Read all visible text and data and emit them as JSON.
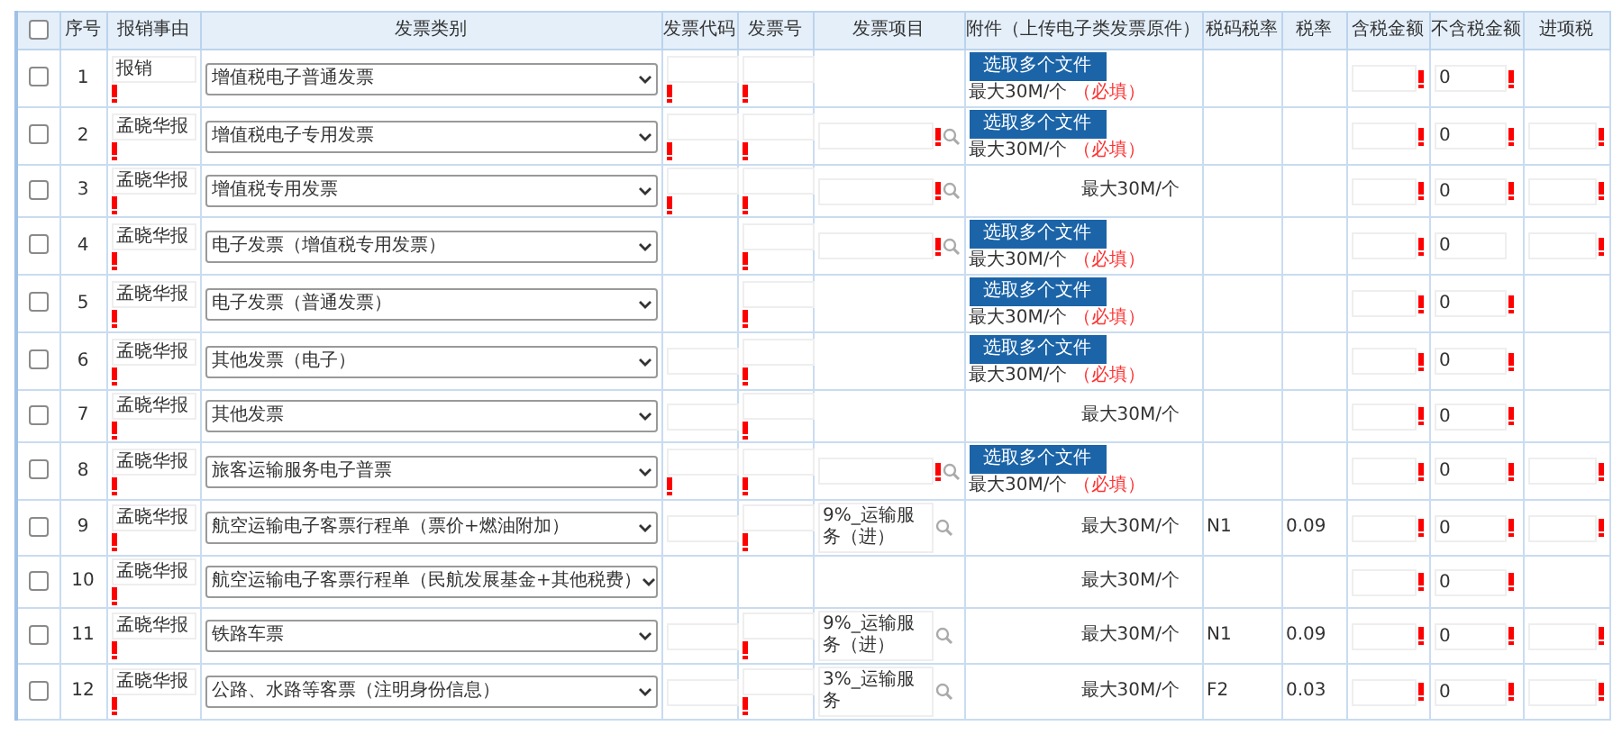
{
  "header": {
    "select_all_checked": false,
    "columns": [
      "序号",
      "报销事由",
      "发票类别",
      "发票代码",
      "发票号",
      "发票项目",
      "附件（上传电子类发票原件）",
      "税码税率",
      "税率",
      "含税金额",
      "不含税金额",
      "进项税"
    ]
  },
  "rows": [
    {
      "checked": false,
      "no": "1",
      "reason": {
        "value": "报销",
        "required": true
      },
      "category": "增值税电子普通发票",
      "code": {
        "required": true
      },
      "number": {
        "required": true
      },
      "attachment": {
        "kind": "upload",
        "button": "选取多个文件",
        "limit": "最大30M/个",
        "note": "（必填）"
      },
      "amount_incl": {
        "required": true
      },
      "amount_excl": {
        "value": "0",
        "required": true
      }
    },
    {
      "checked": false,
      "no": "2",
      "reason": {
        "value": "孟晓华报",
        "required": true
      },
      "category": "增值税电子专用发票",
      "code": {
        "required": true
      },
      "number": {
        "required": true
      },
      "item": {
        "required": true
      },
      "attachment": {
        "kind": "upload",
        "button": "选取多个文件",
        "limit": "最大30M/个",
        "note": "（必填）"
      },
      "amount_incl": {
        "required": true
      },
      "amount_excl": {
        "value": "0",
        "required": true
      },
      "input_tax": {
        "required": true
      }
    },
    {
      "checked": false,
      "no": "3",
      "reason": {
        "value": "孟晓华报",
        "required": true
      },
      "category": "增值税专用发票",
      "code": {
        "required": true
      },
      "number": {
        "required": true
      },
      "item": {
        "required": true
      },
      "attachment": {
        "kind": "note",
        "limit": "最大30M/个"
      },
      "amount_incl": {
        "required": true
      },
      "amount_excl": {
        "value": "0",
        "required": true
      },
      "input_tax": {
        "required": true
      }
    },
    {
      "checked": false,
      "no": "4",
      "reason": {
        "value": "孟晓华报",
        "required": true
      },
      "category": "电子发票（增值税专用发票）",
      "number": {
        "required": true
      },
      "item": {
        "required": true
      },
      "attachment": {
        "kind": "upload",
        "button": "选取多个文件",
        "limit": "最大30M/个",
        "note": "（必填）"
      },
      "amount_incl": {
        "required": true
      },
      "amount_excl": {
        "value": "0",
        "required": false
      },
      "input_tax": {
        "required": true
      }
    },
    {
      "checked": false,
      "no": "5",
      "reason": {
        "value": "孟晓华报",
        "required": true
      },
      "category": "电子发票（普通发票）",
      "number": {
        "required": true
      },
      "attachment": {
        "kind": "upload",
        "button": "选取多个文件",
        "limit": "最大30M/个",
        "note": "（必填）"
      },
      "amount_incl": {
        "required": true
      },
      "amount_excl": {
        "value": "0",
        "required": true
      }
    },
    {
      "checked": false,
      "no": "6",
      "reason": {
        "value": "孟晓华报",
        "required": true
      },
      "category": "其他发票（电子）",
      "code": {
        "required": false
      },
      "number": {
        "required": true
      },
      "attachment": {
        "kind": "upload",
        "button": "选取多个文件",
        "limit": "最大30M/个",
        "note": "（必填）"
      },
      "amount_incl": {
        "required": true
      },
      "amount_excl": {
        "value": "0",
        "required": true
      }
    },
    {
      "checked": false,
      "no": "7",
      "reason": {
        "value": "孟晓华报",
        "required": true
      },
      "category": "其他发票",
      "code": {
        "required": false
      },
      "number": {
        "required": true
      },
      "attachment": {
        "kind": "note",
        "limit": "最大30M/个"
      },
      "amount_incl": {
        "required": true
      },
      "amount_excl": {
        "value": "0",
        "required": true
      }
    },
    {
      "checked": false,
      "no": "8",
      "reason": {
        "value": "孟晓华报",
        "required": true
      },
      "category": "旅客运输服务电子普票",
      "code": {
        "required": true
      },
      "number": {
        "required": true
      },
      "item": {
        "required": true
      },
      "attachment": {
        "kind": "upload",
        "button": "选取多个文件",
        "limit": "最大30M/个",
        "note": "（必填）"
      },
      "amount_incl": {
        "required": true
      },
      "amount_excl": {
        "value": "0",
        "required": true
      },
      "input_tax": {
        "required": true
      }
    },
    {
      "checked": false,
      "no": "9",
      "reason": {
        "value": "孟晓华报",
        "required": true
      },
      "category": "航空运输电子客票行程单（票价+燃油附加）",
      "code": {
        "required": false
      },
      "number": {
        "required": true
      },
      "item": {
        "value": "9%_运输服务（进）",
        "required": false
      },
      "attachment": {
        "kind": "note",
        "limit": "最大30M/个"
      },
      "tax_code": "N1",
      "tax_rate": "0.09",
      "amount_incl": {
        "required": true
      },
      "amount_excl": {
        "value": "0",
        "required": true
      },
      "input_tax": {
        "required": true
      }
    },
    {
      "checked": false,
      "no": "10",
      "reason": {
        "value": "孟晓华报",
        "required": true
      },
      "category": "航空运输电子客票行程单（民航发展基金+其他税费）",
      "attachment": {
        "kind": "note",
        "limit": "最大30M/个"
      },
      "amount_incl": {
        "required": true
      },
      "amount_excl": {
        "value": "0",
        "required": true
      }
    },
    {
      "checked": false,
      "no": "11",
      "reason": {
        "value": "孟晓华报",
        "required": true
      },
      "category": "铁路车票",
      "code": {
        "required": false
      },
      "number": {
        "required": true
      },
      "item": {
        "value": "9%_运输服务（进）",
        "required": false
      },
      "attachment": {
        "kind": "note",
        "limit": "最大30M/个"
      },
      "tax_code": "N1",
      "tax_rate": "0.09",
      "amount_incl": {
        "required": true
      },
      "amount_excl": {
        "value": "0",
        "required": true
      },
      "input_tax": {
        "required": true
      }
    },
    {
      "checked": false,
      "no": "12",
      "reason": {
        "value": "孟晓华报",
        "required": true
      },
      "category": "公路、水路等客票（注明身份信息）",
      "code": {
        "required": false
      },
      "number": {
        "required": true
      },
      "item": {
        "value": "3%_运输服务",
        "required": false
      },
      "attachment": {
        "kind": "note",
        "limit": "最大30M/个"
      },
      "tax_code": "F2",
      "tax_rate": "0.03",
      "amount_incl": {
        "required": true
      },
      "amount_excl": {
        "value": "0",
        "required": true
      },
      "input_tax": {
        "required": true
      }
    }
  ]
}
